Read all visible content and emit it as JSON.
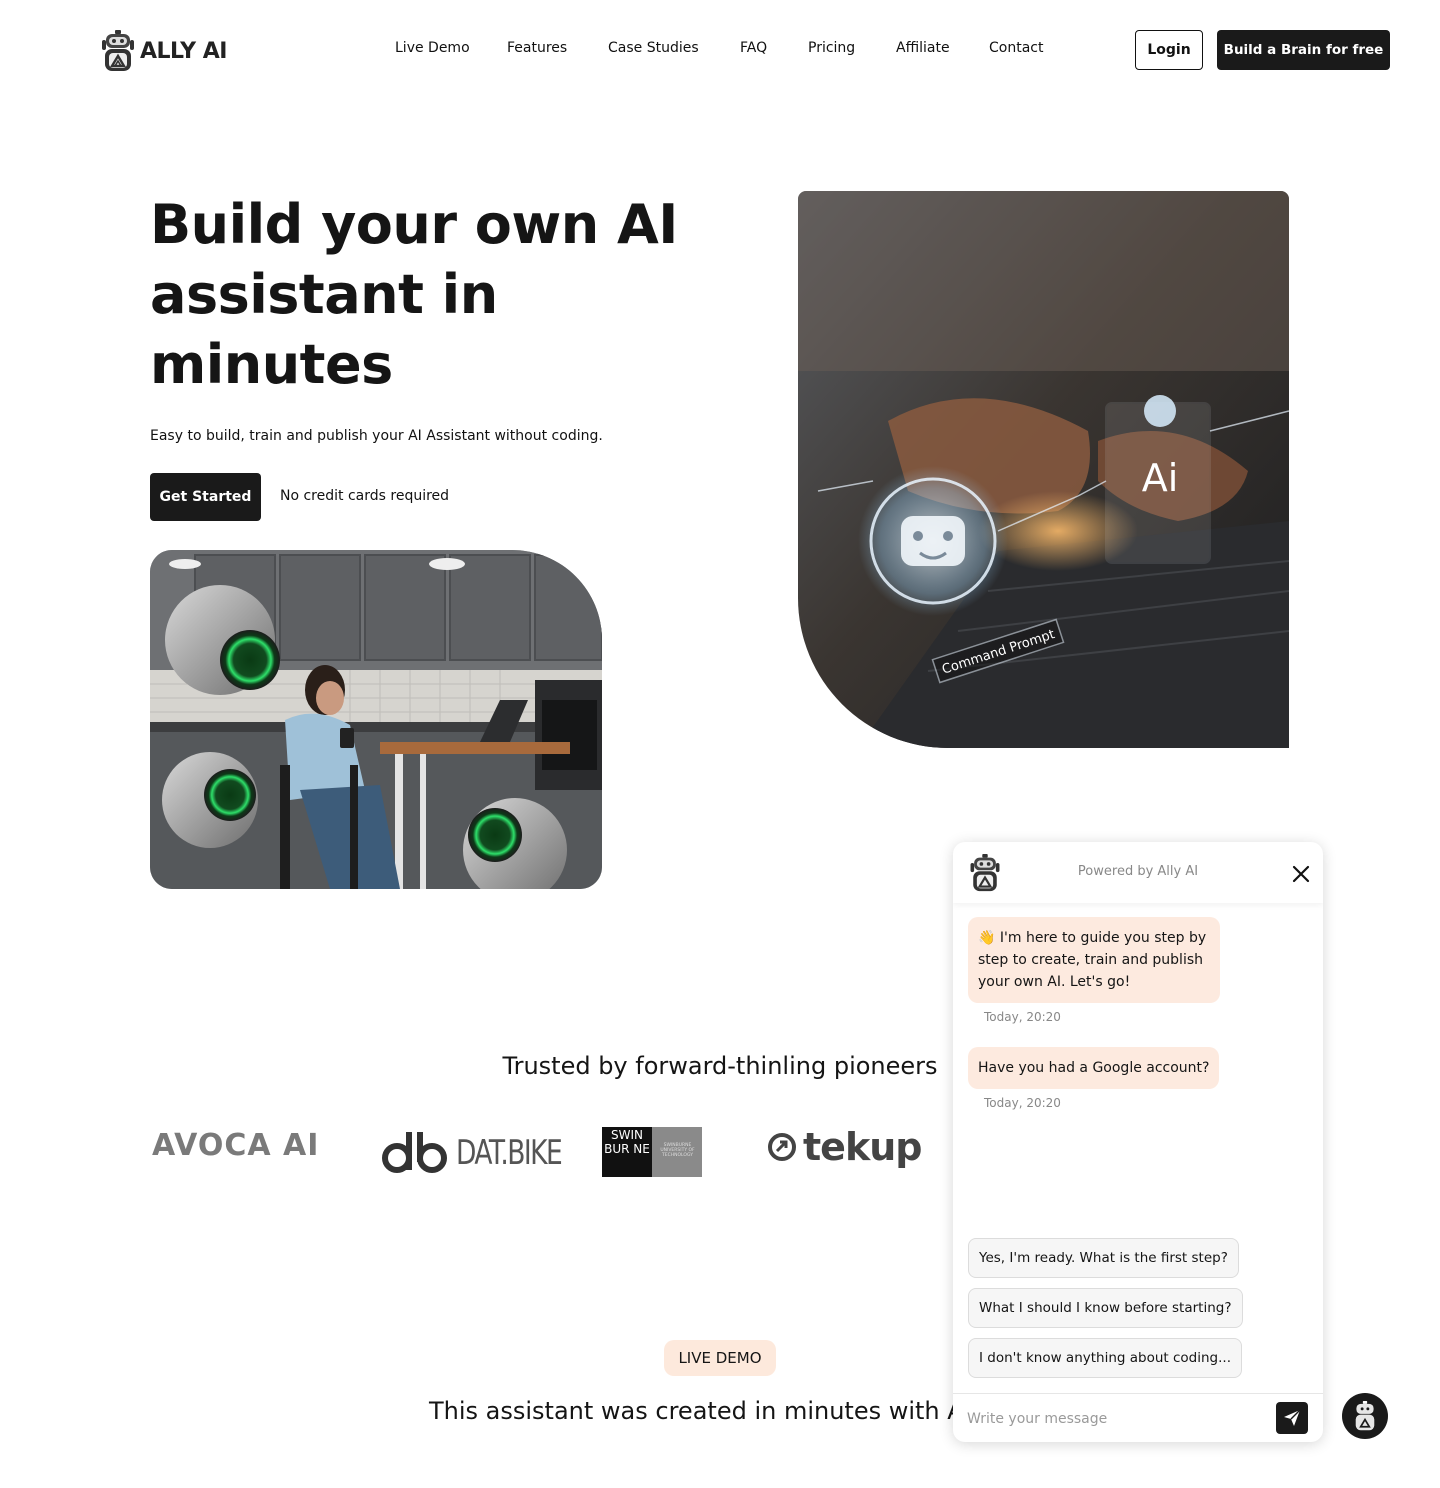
{
  "brand": {
    "name": "ALLY AI",
    "logo_icon": "robot-logo-icon"
  },
  "nav": {
    "items": [
      {
        "label": "Live Demo"
      },
      {
        "label": "Features"
      },
      {
        "label": "Case Studies"
      },
      {
        "label": "FAQ"
      },
      {
        "label": "Pricing"
      },
      {
        "label": "Affiliate"
      },
      {
        "label": "Contact"
      }
    ],
    "login_label": "Login",
    "cta_label": "Build a Brain for free"
  },
  "hero": {
    "title": "Build your own AI assistant in minutes",
    "subtitle": "Easy to build, train and publish your AI Assistant without coding.",
    "cta_label": "Get Started",
    "note": "No credit cards required"
  },
  "trusted": {
    "title": "Trusted by forward-thinling pioneers",
    "partners": [
      {
        "name": "AVOCA AI"
      },
      {
        "name": "DAT.BIKE"
      },
      {
        "name": "SWIN BUR NE",
        "subtext": "SWINBURNE UNIVERSITY OF TECHNOLOGY"
      },
      {
        "name": "tekup"
      }
    ]
  },
  "live_demo": {
    "badge": "LIVE DEMO",
    "subtitle": "This assistant was created in minutes with A"
  },
  "chat": {
    "powered_by": "Powered by Ally AI",
    "messages": [
      {
        "text": "👋 I'm here to guide you step by step to create, train and publish your own AI. Let's go!",
        "time": "Today, 20:20"
      },
      {
        "text": "Have you had a Google account?",
        "time": "Today, 20:20"
      }
    ],
    "suggestions": [
      {
        "label": "Yes, I'm ready. What is the first step?"
      },
      {
        "label": "What I should I know before starting?"
      },
      {
        "label": "I don't know anything about coding..."
      }
    ],
    "input_placeholder": "Write your message"
  },
  "colors": {
    "primary_dark": "#1a1a1a",
    "bot_bubble": "#fdeadf",
    "badge_bg": "#fde9dc",
    "muted_text": "#888888",
    "glow_green": "#2ee06a"
  }
}
